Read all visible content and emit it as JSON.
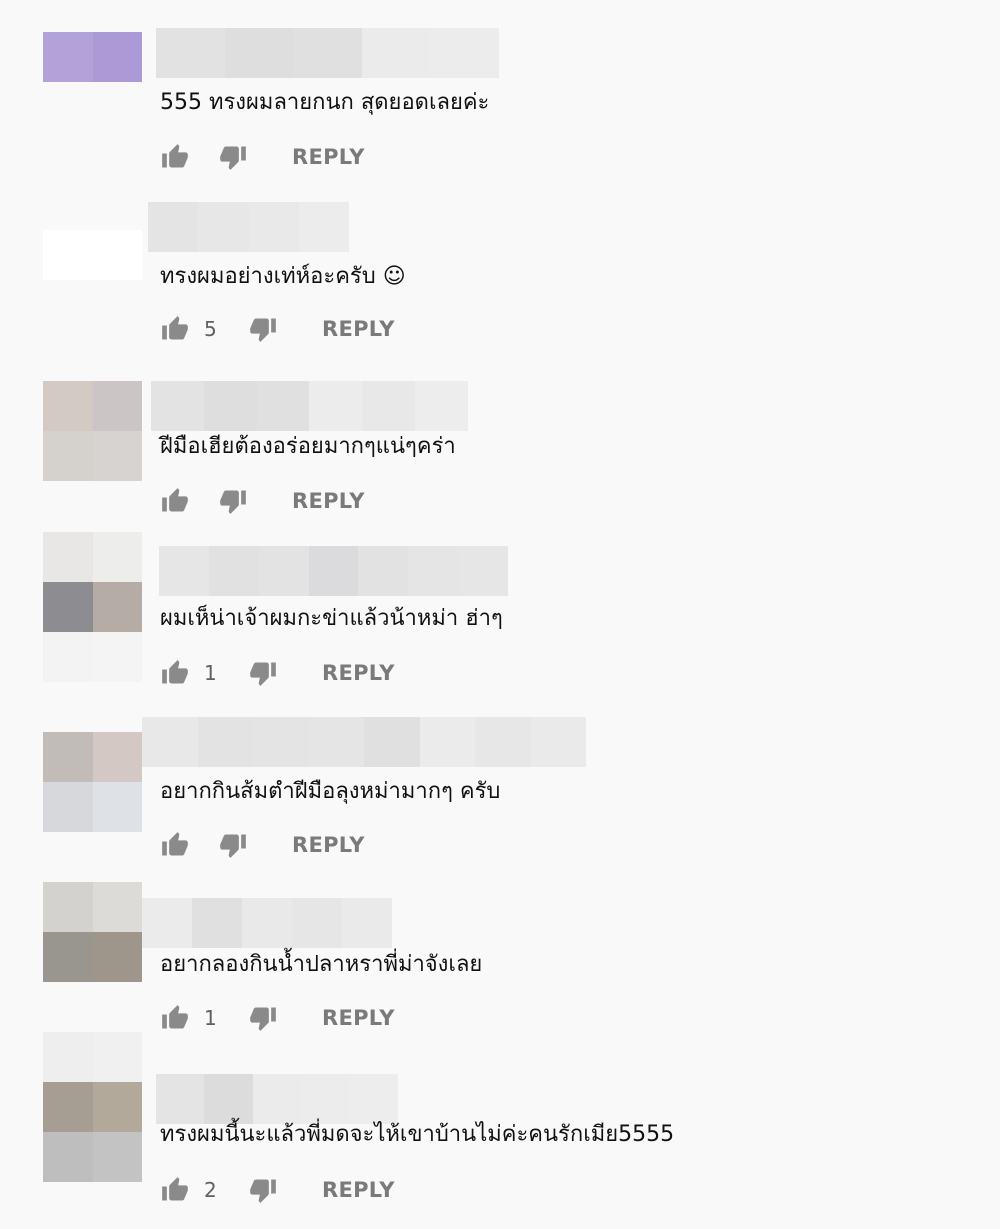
{
  "reply_label": "REPLY",
  "icons": {
    "like": "thumbs-up-icon",
    "dislike": "thumbs-down-icon"
  },
  "comments": [
    {
      "text": "555 ทรงผมลายกนก สุดยอดเลยค่ะ",
      "likes": ""
    },
    {
      "text": "ทรงผมอย่างเท่ห์อะครับ ☺",
      "likes": "5"
    },
    {
      "text": "ฝีมือเฮียต้องอร่อยมากๆแน่ๆคร่า",
      "likes": ""
    },
    {
      "text": "ผมเห็น่าเจ้าผมกะข่าแล้วน้าหม่า ฮ่าๆ",
      "likes": "1"
    },
    {
      "text": "อยากกินส้มตำฝีมือลุงหม่ามากๆ ครับ",
      "likes": ""
    },
    {
      "text": "อยากลองกินน้ำปลาหราพี่ม่าจังเลย",
      "likes": "1"
    },
    {
      "text": "ทรงผมนี้นะแล้วพี่มดจะไห้เขาบ้านไม่ค่ะคนรักเมีย5555",
      "likes": "2"
    }
  ]
}
